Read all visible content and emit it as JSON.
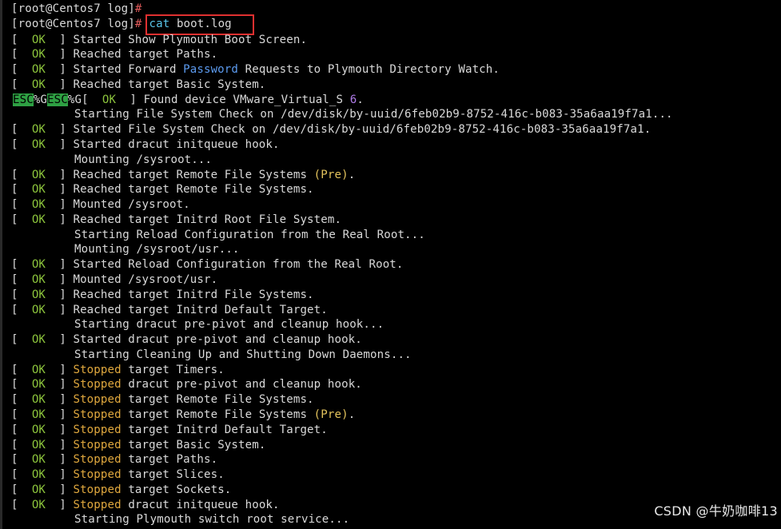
{
  "prompt": {
    "user_host": "[root@Centos7 log]",
    "hash": "#",
    "command_name": "cat",
    "command_arg": " boot.log"
  },
  "ok_label": "  OK  ",
  "lines": [
    {
      "status": "OK",
      "text": "Started Show Plymouth Boot Screen."
    },
    {
      "status": "OK",
      "text": "Reached target Paths."
    },
    {
      "status": "OK",
      "text": "Started Forward ",
      "highlight": "Password",
      "rest": " Requests to Plymouth Directory Watch."
    },
    {
      "status": "OK",
      "text": "Reached target Basic System."
    },
    {
      "status": "ESC",
      "esc1": "ESC",
      "mid": "%G",
      "esc2": "ESC",
      "tail": "%G",
      "text": "Found device VMware_Virtual_S ",
      "num": "6",
      "rest": "."
    },
    {
      "status": "",
      "text": "Starting File System Check on /dev/disk/by-uuid/6feb02b9-8752-416c-b083-35a6aa19f7a1..."
    },
    {
      "status": "OK",
      "text": "Started File System Check on /dev/disk/by-uuid/6feb02b9-8752-416c-b083-35a6aa19f7a1."
    },
    {
      "status": "OK",
      "text": "Started dracut initqueue hook."
    },
    {
      "status": "",
      "text": "Mounting /sysroot..."
    },
    {
      "status": "OK",
      "text": "Reached target Remote File Systems ",
      "paren": "(Pre)",
      "rest": "."
    },
    {
      "status": "OK",
      "text": "Reached target Remote File Systems."
    },
    {
      "status": "OK",
      "text": "Mounted /sysroot."
    },
    {
      "status": "OK",
      "text": "Reached target Initrd Root File System."
    },
    {
      "status": "",
      "text": "Starting Reload Configuration from the Real Root..."
    },
    {
      "status": "",
      "text": "Mounting /sysroot/usr..."
    },
    {
      "status": "OK",
      "text": "Started Reload Configuration from the Real Root."
    },
    {
      "status": "OK",
      "text": "Mounted /sysroot/usr."
    },
    {
      "status": "OK",
      "text": "Reached target Initrd File Systems."
    },
    {
      "status": "OK",
      "text": "Reached target Initrd Default Target."
    },
    {
      "status": "",
      "text": "Starting dracut pre-pivot and cleanup hook..."
    },
    {
      "status": "OK",
      "text": "Started dracut pre-pivot and cleanup hook."
    },
    {
      "status": "",
      "text": "Starting Cleaning Up and Shutting Down Daemons..."
    },
    {
      "status": "OK",
      "stopped": "Stopped",
      "text": " target Timers."
    },
    {
      "status": "OK",
      "stopped": "Stopped",
      "text": " dracut pre-pivot and cleanup hook."
    },
    {
      "status": "OK",
      "stopped": "Stopped",
      "text": " target Remote File Systems."
    },
    {
      "status": "OK",
      "stopped": "Stopped",
      "text": " target Remote File Systems ",
      "paren": "(Pre)",
      "rest": "."
    },
    {
      "status": "OK",
      "stopped": "Stopped",
      "text": " target Initrd Default Target."
    },
    {
      "status": "OK",
      "stopped": "Stopped",
      "text": " target Basic System."
    },
    {
      "status": "OK",
      "stopped": "Stopped",
      "text": " target Paths."
    },
    {
      "status": "OK",
      "stopped": "Stopped",
      "text": " target Slices."
    },
    {
      "status": "OK",
      "stopped": "Stopped",
      "text": " target Sockets."
    },
    {
      "status": "OK",
      "stopped": "Stopped",
      "text": " dracut initqueue hook."
    },
    {
      "status": "",
      "text": "Starting Plymouth switch root service..."
    }
  ],
  "watermark": "CSDN @牛奶咖啡13"
}
